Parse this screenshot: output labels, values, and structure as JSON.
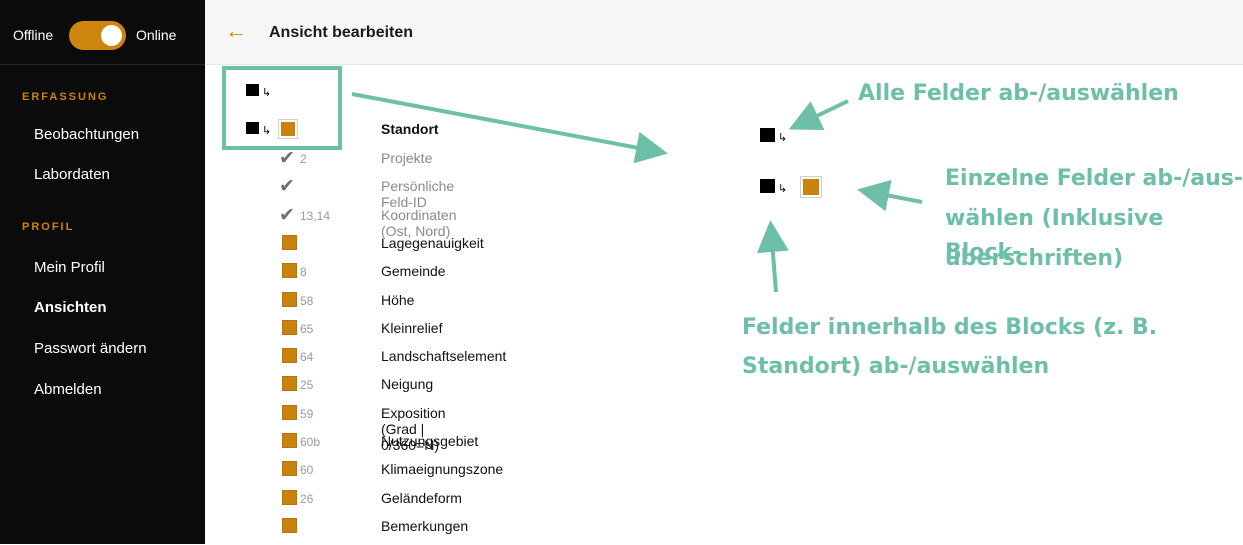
{
  "toggle": {
    "offline": "Offline",
    "online": "Online"
  },
  "sidebar": {
    "section_erfassung": "ERFASSUNG",
    "beobachtungen": "Beobachtungen",
    "labordaten": "Labordaten",
    "section_profil": "PROFIL",
    "mein_profil": "Mein Profil",
    "ansichten": "Ansichten",
    "passwort": "Passwort ändern",
    "abmelden": "Abmelden"
  },
  "header": {
    "title": "Ansicht bearbeiten"
  },
  "block": {
    "title": "Standort"
  },
  "fields": [
    {
      "type": "check",
      "num": "2",
      "name": "Projekte"
    },
    {
      "type": "check",
      "num": "",
      "name": "Persönliche Feld-ID"
    },
    {
      "type": "check",
      "num": "13,14",
      "name": "Koordinaten (Ost, Nord)"
    },
    {
      "type": "box",
      "num": "",
      "name": "Lagegenauigkeit"
    },
    {
      "type": "box",
      "num": "8",
      "name": "Gemeinde"
    },
    {
      "type": "box",
      "num": "58",
      "name": "Höhe"
    },
    {
      "type": "box",
      "num": "65",
      "name": "Kleinrelief"
    },
    {
      "type": "box",
      "num": "64",
      "name": "Landschaftselement"
    },
    {
      "type": "box",
      "num": "25",
      "name": "Neigung"
    },
    {
      "type": "box",
      "num": "59",
      "name": "Exposition (Grad | 0/360=N)"
    },
    {
      "type": "box",
      "num": "60b",
      "name": "Nutzungsgebiet"
    },
    {
      "type": "box",
      "num": "60",
      "name": "Klimaeignungszone"
    },
    {
      "type": "box",
      "num": "26",
      "name": "Geländeform"
    },
    {
      "type": "box",
      "num": "",
      "name": "Bemerkungen"
    }
  ],
  "annotations": {
    "alle": "Alle Felder ab-/auswählen",
    "einzelne_1": "Einzelne Felder ab-/aus-",
    "einzelne_2": "wählen (Inklusive Block-",
    "einzelne_3": "überschriften)",
    "block_1": "Felder innerhalb des Blocks (z. B.",
    "block_2": "Standort) ab-/auswählen"
  },
  "colors": {
    "accent": "#cf860f",
    "annotation": "#6dbfa8",
    "sidebar": "#0b0b0b"
  }
}
